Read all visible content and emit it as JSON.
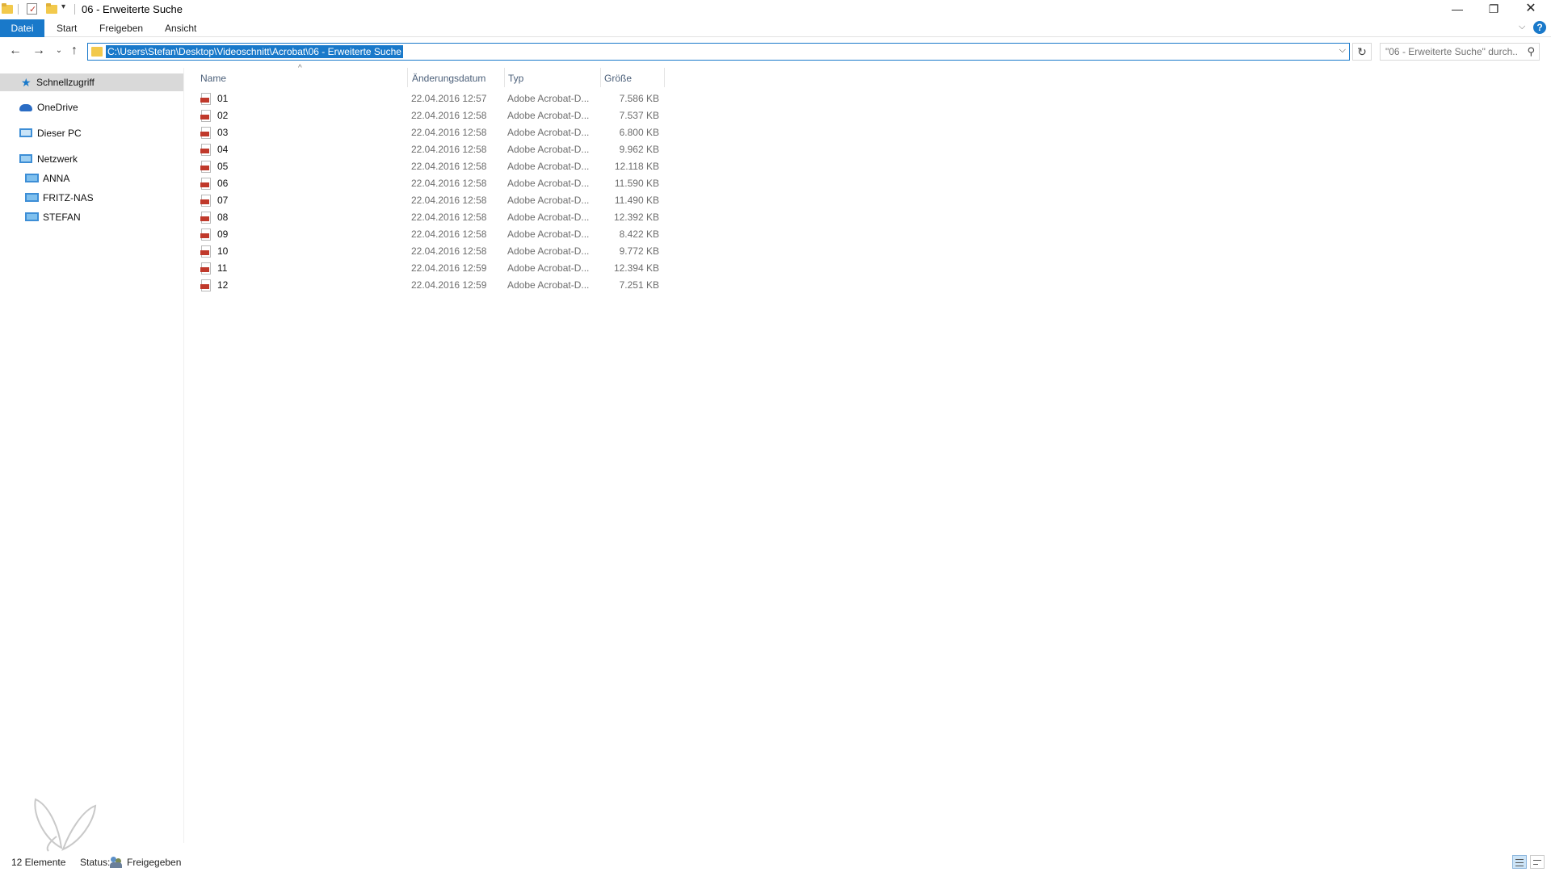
{
  "window": {
    "title": "06 - Erweiterte Suche",
    "minimize_glyph": "—",
    "restore_glyph": "❐",
    "close_glyph": "✕"
  },
  "quick_access_toolbar": {
    "dropdown_glyph": "▾",
    "icons": [
      "folder-icon",
      "properties-icon",
      "new-folder-icon"
    ]
  },
  "ribbon": {
    "tabs": [
      {
        "label": "Datei",
        "active": true
      },
      {
        "label": "Start"
      },
      {
        "label": "Freigeben"
      },
      {
        "label": "Ansicht"
      }
    ],
    "expand_glyph": "⌵",
    "help_glyph": "?",
    "accent_color": "#1979ca"
  },
  "navigation": {
    "back_glyph": "←",
    "forward_glyph": "→",
    "recent_glyph": "⌄",
    "up_glyph": "↑",
    "address": "C:\\Users\\Stefan\\Desktop\\Videoschnitt\\Acrobat\\06 - Erweiterte Suche",
    "address_dropdown_glyph": "⌵",
    "refresh_glyph": "↻",
    "search_placeholder": "\"06 - Erweiterte Suche\" durch...",
    "search_glyph": "⚲"
  },
  "sidebar": {
    "items": [
      {
        "label": "Schnellzugriff",
        "icon": "star-icon",
        "selected": true
      },
      {
        "label": "OneDrive",
        "icon": "cloud-icon"
      },
      {
        "label": "Dieser PC",
        "icon": "computer-icon"
      },
      {
        "label": "Netzwerk",
        "icon": "network-icon"
      },
      {
        "label": "ANNA",
        "icon": "computer-icon"
      },
      {
        "label": "FRITZ-NAS",
        "icon": "computer-icon"
      },
      {
        "label": "STEFAN",
        "icon": "computer-icon"
      }
    ],
    "quick_access_star": "★"
  },
  "file_list": {
    "sort_glyph": "^",
    "columns": {
      "name": "Name",
      "date": "Änderungsdatum",
      "type": "Typ",
      "size": "Größe"
    },
    "rows": [
      {
        "name": "01",
        "date": "22.04.2016 12:57",
        "type": "Adobe Acrobat-D...",
        "size": "7.586 KB"
      },
      {
        "name": "02",
        "date": "22.04.2016 12:58",
        "type": "Adobe Acrobat-D...",
        "size": "7.537 KB"
      },
      {
        "name": "03",
        "date": "22.04.2016 12:58",
        "type": "Adobe Acrobat-D...",
        "size": "6.800 KB"
      },
      {
        "name": "04",
        "date": "22.04.2016 12:58",
        "type": "Adobe Acrobat-D...",
        "size": "9.962 KB"
      },
      {
        "name": "05",
        "date": "22.04.2016 12:58",
        "type": "Adobe Acrobat-D...",
        "size": "12.118 KB"
      },
      {
        "name": "06",
        "date": "22.04.2016 12:58",
        "type": "Adobe Acrobat-D...",
        "size": "11.590 KB"
      },
      {
        "name": "07",
        "date": "22.04.2016 12:58",
        "type": "Adobe Acrobat-D...",
        "size": "11.490 KB"
      },
      {
        "name": "08",
        "date": "22.04.2016 12:58",
        "type": "Adobe Acrobat-D...",
        "size": "12.392 KB"
      },
      {
        "name": "09",
        "date": "22.04.2016 12:58",
        "type": "Adobe Acrobat-D...",
        "size": "8.422 KB"
      },
      {
        "name": "10",
        "date": "22.04.2016 12:58",
        "type": "Adobe Acrobat-D...",
        "size": "9.772 KB"
      },
      {
        "name": "11",
        "date": "22.04.2016 12:59",
        "type": "Adobe Acrobat-D...",
        "size": "12.394 KB"
      },
      {
        "name": "12",
        "date": "22.04.2016 12:59",
        "type": "Adobe Acrobat-D...",
        "size": "7.251 KB"
      }
    ]
  },
  "status_bar": {
    "count": "12 Elemente",
    "status_label": "Status:",
    "status_value": "Freigegeben"
  }
}
